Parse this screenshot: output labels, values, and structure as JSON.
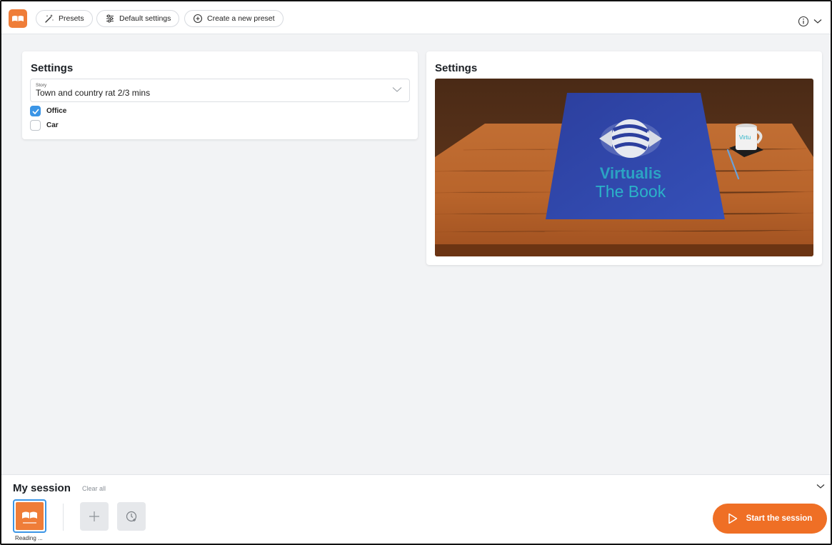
{
  "toolbar": {
    "presets_label": "Presets",
    "default_settings_label": "Default settings",
    "create_preset_label": "Create a new preset"
  },
  "settings_card": {
    "title": "Settings",
    "story_label": "Story",
    "story_value": "Town and country rat 2/3 mins",
    "options": [
      {
        "label": "Office",
        "checked": true
      },
      {
        "label": "Car",
        "checked": false
      }
    ]
  },
  "preview_card": {
    "title": "Settings",
    "book_title_line1": "Virtualis",
    "book_title_line2": "The Book",
    "mug_text": "Virtu"
  },
  "session": {
    "title": "My session",
    "clear_all_label": "Clear all",
    "items": [
      {
        "caption": "Reading ..."
      }
    ],
    "start_label": "Start the session"
  },
  "colors": {
    "accent_orange": "#ef6f25",
    "check_blue": "#3b95e6",
    "book_blue": "#2f45a8",
    "table_wood": "#b8642b"
  },
  "icons": {
    "presets": "magic-wand-icon",
    "default_settings": "sliders-icon",
    "create_preset": "plus-circle-icon",
    "info": "info-circle-icon",
    "add": "plus-icon",
    "schedule": "clock-plus-icon",
    "start": "play-icon"
  }
}
